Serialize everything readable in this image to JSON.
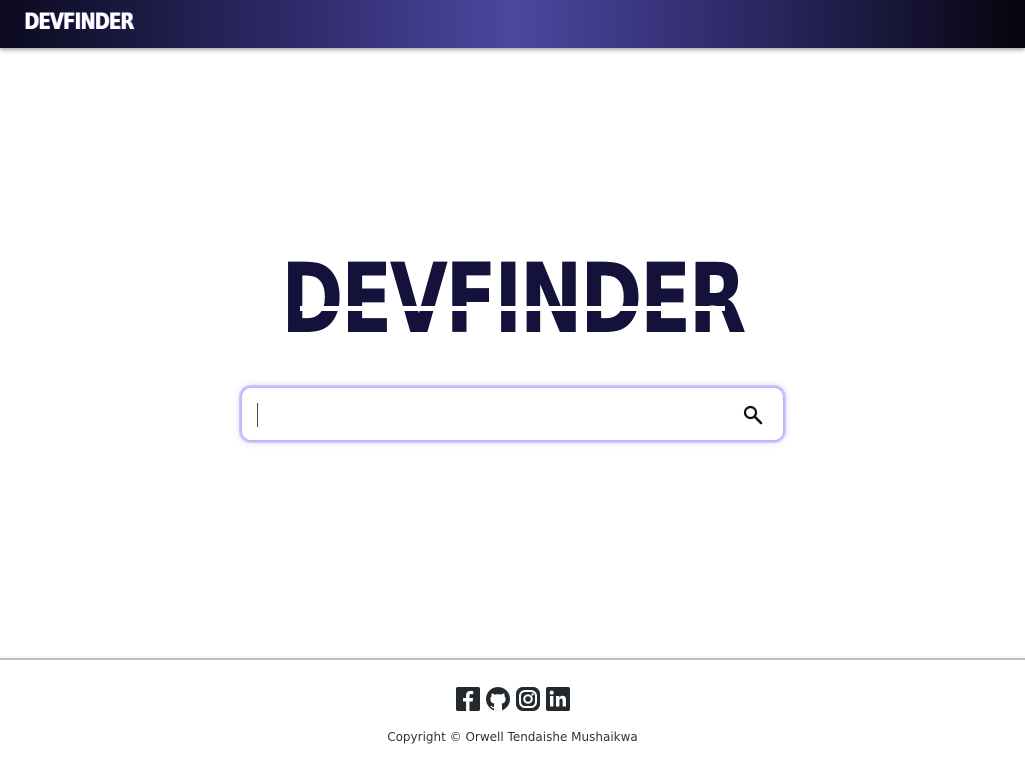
{
  "header": {
    "logo_text": "DEVFINDER"
  },
  "hero": {
    "logo_text": "DEVFINDER"
  },
  "search": {
    "value": "",
    "placeholder": "",
    "button_icon": "search-icon"
  },
  "footer": {
    "social": [
      {
        "name": "facebook",
        "icon": "facebook-icon"
      },
      {
        "name": "github",
        "icon": "github-icon"
      },
      {
        "name": "instagram",
        "icon": "instagram-icon"
      },
      {
        "name": "linkedin",
        "icon": "linkedin-icon"
      }
    ],
    "copyright": "Copyright © Orwell Tendaishe Mushaikwa"
  },
  "colors": {
    "header_gradient_center": "#4c47a0",
    "header_gradient_edge": "#0b0a1f",
    "logo_dark": "#14123a",
    "search_glow": "#8c82ff",
    "icon_dark": "#24292e"
  }
}
